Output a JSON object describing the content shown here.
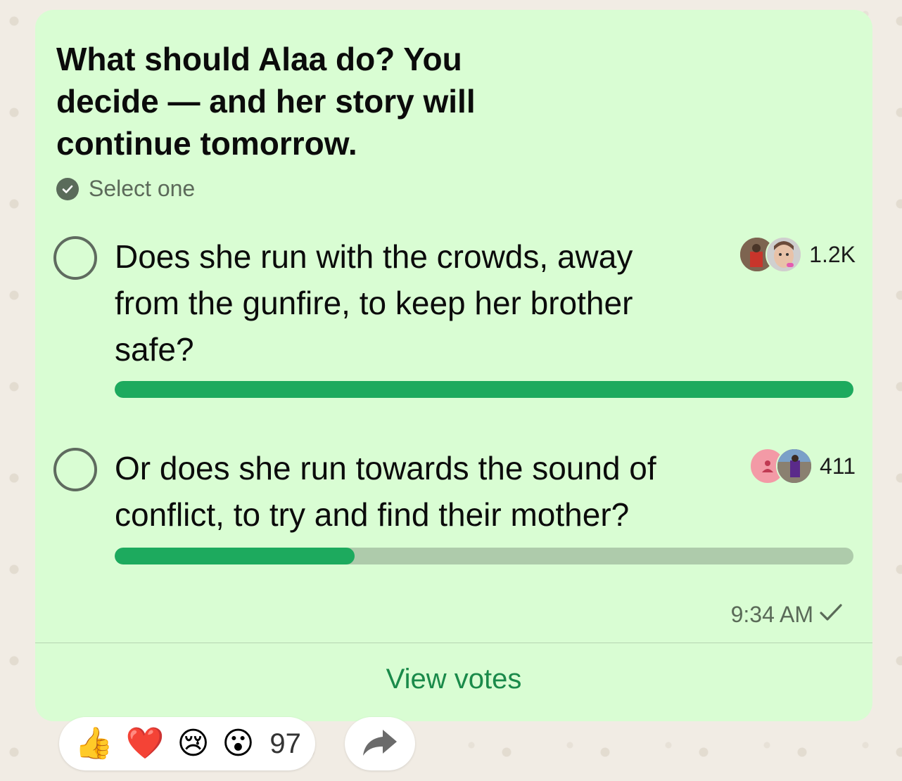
{
  "poll": {
    "question": "What should Alaa do? You decide — and her story will continue tomorrow.",
    "select_hint": "Select one",
    "options": [
      {
        "text": "Does she run with the crowds, away from the gunfire, to keep her brother safe?",
        "votes": "1.2K",
        "vote_fraction": 1.0
      },
      {
        "text": "Or does she run towards the sound of conflict, to try and find their mother?",
        "votes": "411",
        "vote_fraction": 0.325
      }
    ],
    "time": "9:34 AM",
    "view_votes_label": "View votes"
  },
  "reactions": {
    "emojis": [
      "👍",
      "❤️",
      "😢",
      "😮"
    ],
    "count": "97"
  },
  "colors": {
    "bubble": "#d9fdd3",
    "bar_fill": "#1daa5e",
    "bar_track": "#aecbab",
    "link": "#1a8a4a"
  }
}
